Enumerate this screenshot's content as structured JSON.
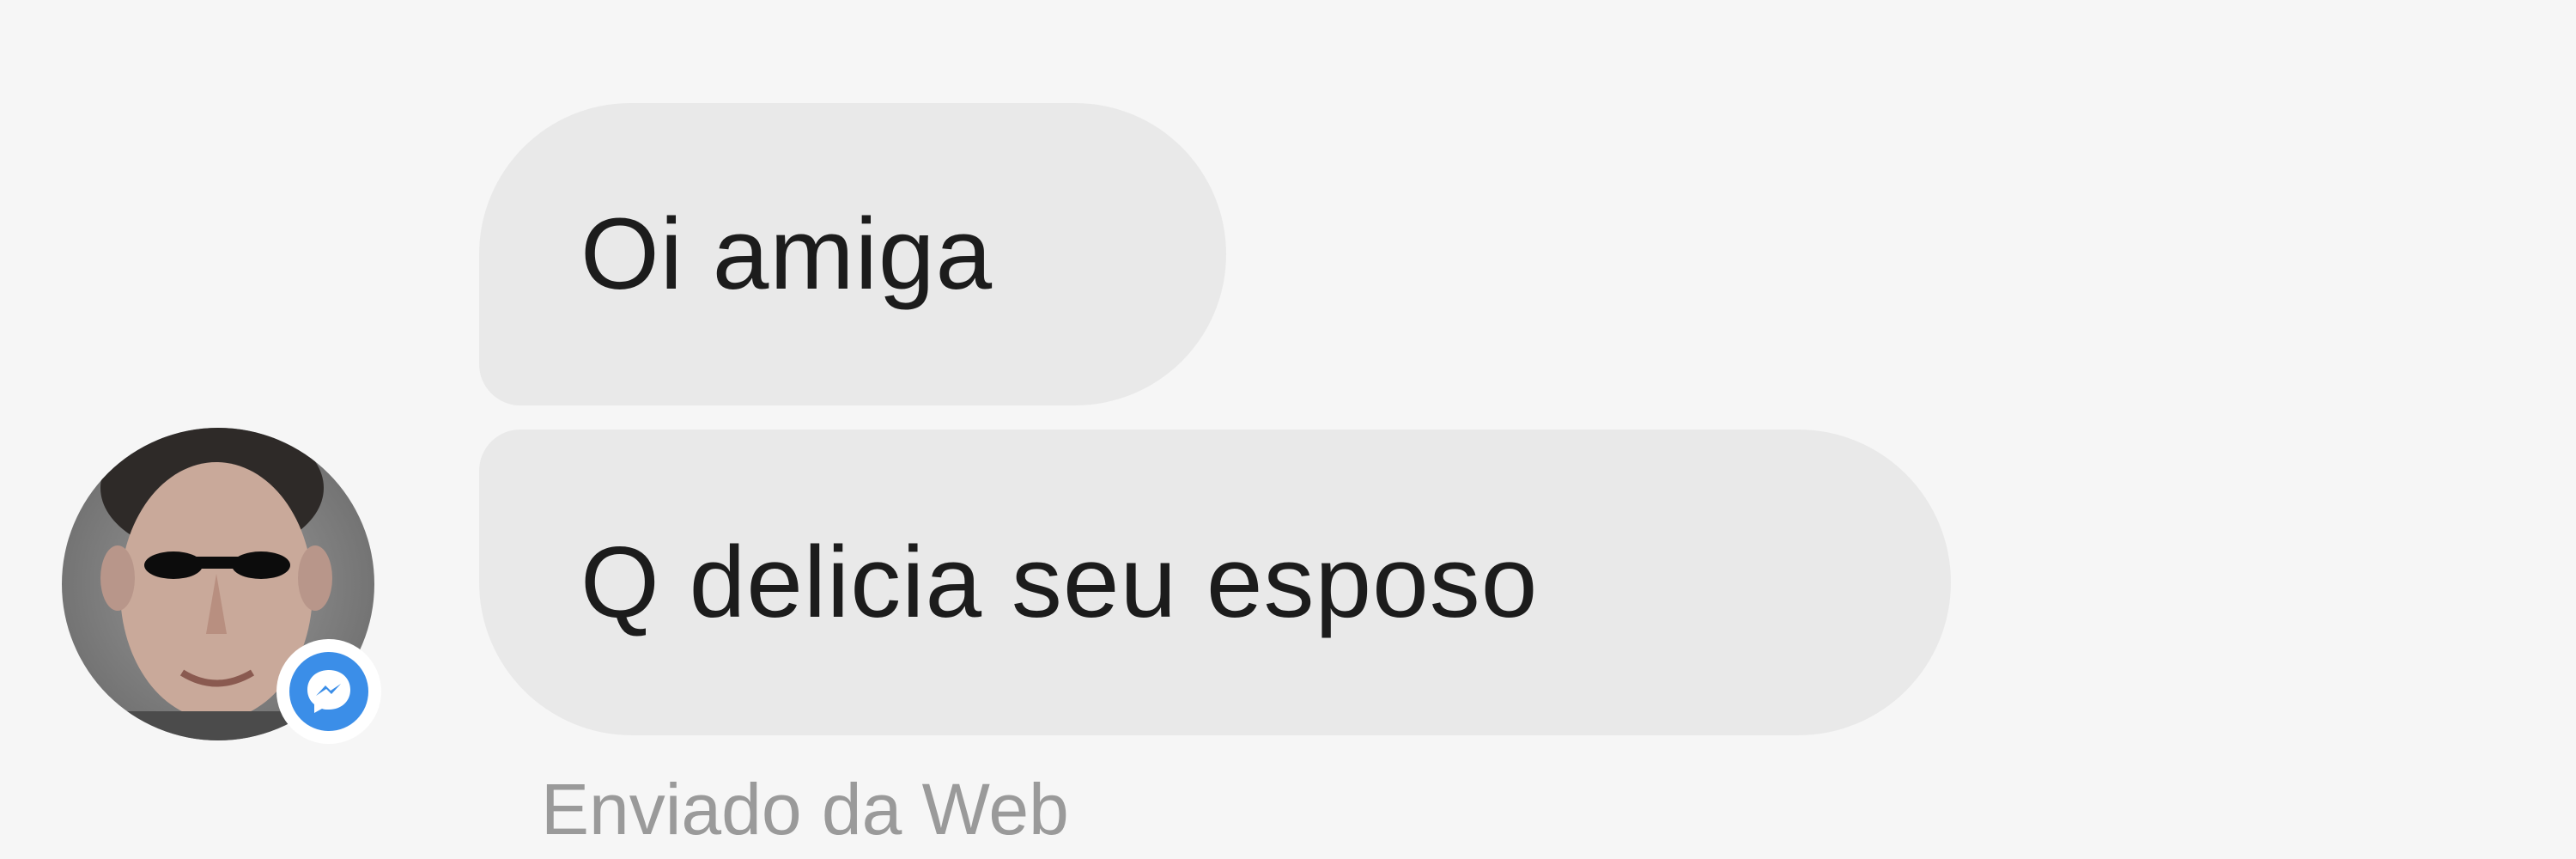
{
  "messages": [
    {
      "text": "Oi amiga"
    },
    {
      "text": "Q delicia seu esposo"
    }
  ],
  "footer": {
    "sent_from": "Enviado da Web"
  },
  "sender": {
    "avatar_icon": "profile-photo",
    "badge_icon": "messenger-icon",
    "badge_color": "#3b8ee8"
  },
  "colors": {
    "background": "#f6f6f6",
    "bubble": "#e9e9e9",
    "message_text": "#1c1c1c",
    "caption_text": "#9a9a9a"
  }
}
